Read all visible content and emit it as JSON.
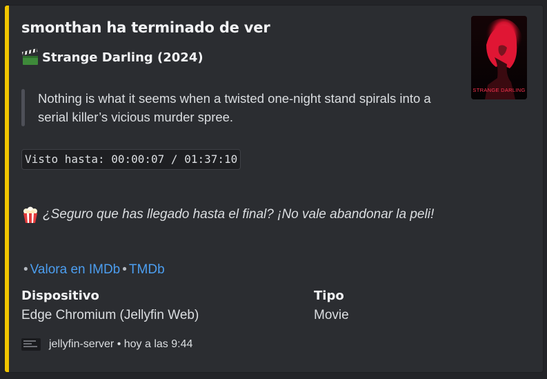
{
  "embed": {
    "accent_color": "#f0c400",
    "author": "smonthan ha terminado de ver",
    "title": {
      "icon": "clapper-board-icon",
      "text": "Strange Darling (2024)"
    },
    "description": "Nothing is what it seems when a twisted one-night stand spirals into a serial killer’s vicious murder spree.",
    "watched_until": "Visto hasta: 00:00:07 / 01:37:10",
    "note": {
      "icon": "popcorn-icon",
      "text": "¿Seguro que has llegado hasta el final? ¡No vale abandonar la peli!"
    },
    "links": {
      "bullet": "•",
      "imdb": "Valora en IMDb",
      "tmdb": "TMDb"
    },
    "fields": [
      {
        "name": "Dispositivo",
        "value": "Edge Chromium (Jellyfin Web)"
      },
      {
        "name": "Tipo",
        "value": "Movie"
      }
    ],
    "footer": {
      "icon": "jellyfin-server-icon",
      "text": "jellyfin-server • hoy a las 9:44"
    },
    "thumbnail": {
      "icon": "movie-poster",
      "caption": "STRANGE DARLING"
    }
  }
}
